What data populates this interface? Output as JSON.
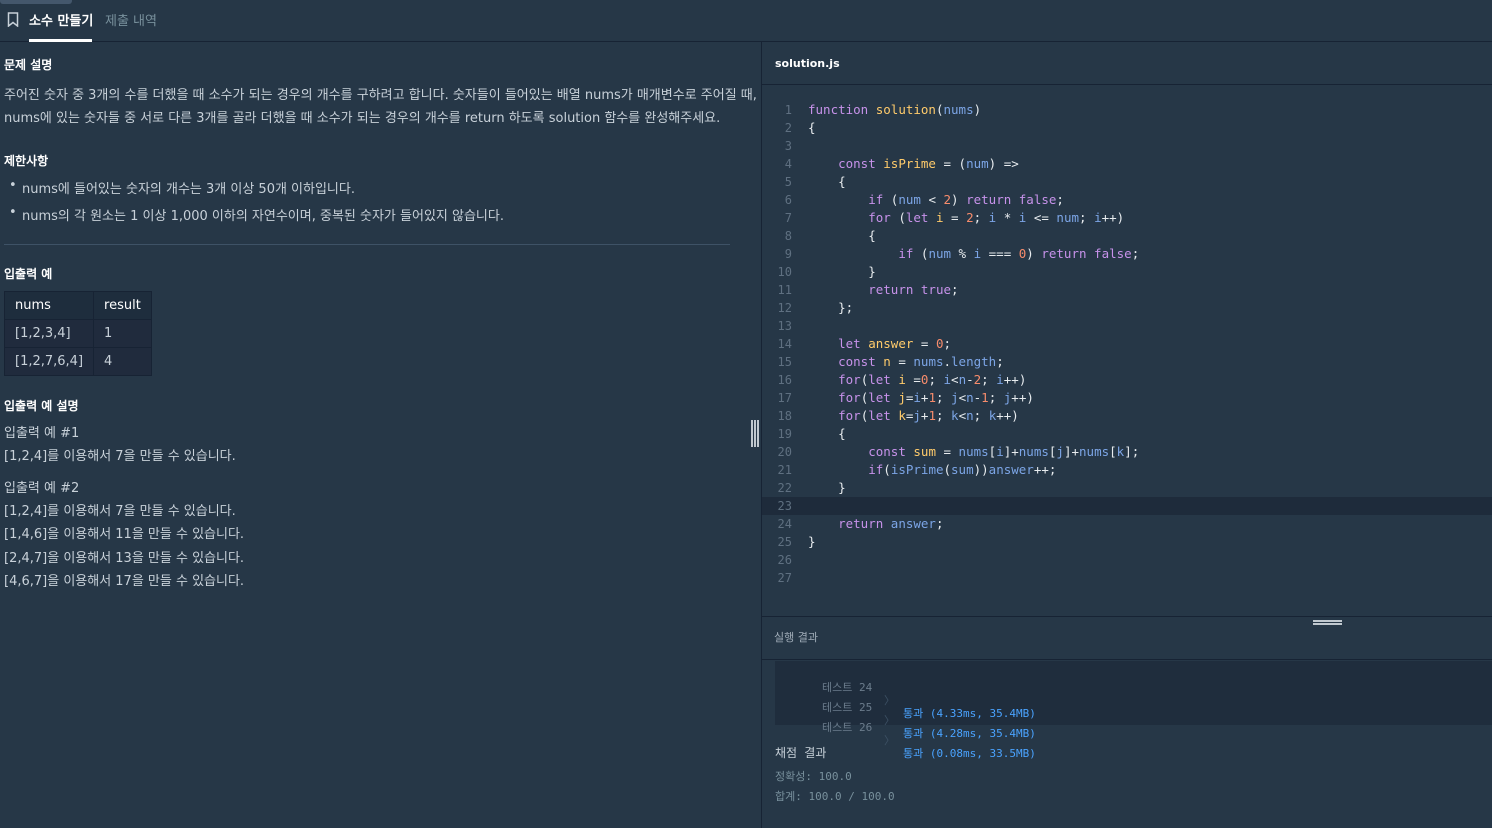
{
  "tabs": {
    "active": "소수 만들기",
    "inactive": "제출 내역"
  },
  "problem": {
    "desc_title": "문제 설명",
    "desc_line1": "주어진 숫자 중 3개의 수를 더했을 때 소수가 되는 경우의 개수를 구하려고 합니다. 숫자들이 들어있는 배열 nums가 매개변수로 주어질 때,",
    "desc_line2": "nums에 있는 숫자들 중 서로 다른 3개를 골라 더했을 때 소수가 되는 경우의 개수를 return 하도록 solution 함수를 완성해주세요.",
    "limits_title": "제한사항",
    "limit1": "nums에 들어있는 숫자의 개수는 3개 이상 50개 이하입니다.",
    "limit2": "nums의 각 원소는 1 이상 1,000 이하의 자연수이며, 중복된 숫자가 들어있지 않습니다.",
    "io_title": "입출력 예",
    "table": {
      "headers": [
        "nums",
        "result"
      ],
      "rows": [
        [
          "[1,2,3,4]",
          "1"
        ],
        [
          "[1,2,7,6,4]",
          "4"
        ]
      ]
    },
    "io_desc_title": "입출력 예 설명",
    "ex1_title": "입출력 예 #1",
    "ex1_line1": "[1,2,4]를 이용해서 7을 만들 수 있습니다.",
    "ex2_title": "입출력 예 #2",
    "ex2_line1": "[1,2,4]를 이용해서 7을 만들 수 있습니다.",
    "ex2_line2": "[1,4,6]을 이용해서 11을 만들 수 있습니다.",
    "ex2_line3": "[2,4,7]을 이용해서 13을 만들 수 있습니다.",
    "ex2_line4": "[4,6,7]을 이용해서 17을 만들 수 있습니다."
  },
  "editor": {
    "filename": "solution.js",
    "current_line": 23
  },
  "results": {
    "title": "실행 결과",
    "tests": [
      {
        "name": "테스트 24",
        "sep": "〉",
        "result": "통과 (4.33ms, 35.4MB)"
      },
      {
        "name": "테스트 25",
        "sep": "〉",
        "result": "통과 (4.28ms, 35.4MB)"
      },
      {
        "name": "테스트 26",
        "sep": "〉",
        "result": "통과 (0.08ms, 33.5MB)"
      }
    ],
    "grade_title": "채점 결과",
    "accuracy": "정확성: 100.0",
    "total": "합계: 100.0 / 100.0"
  },
  "colors": {
    "background": "#263747",
    "pass": "#4aa3ff",
    "keyword": "#c792ea",
    "function_name": "#ffcb6b",
    "number": "#f78c6c"
  }
}
